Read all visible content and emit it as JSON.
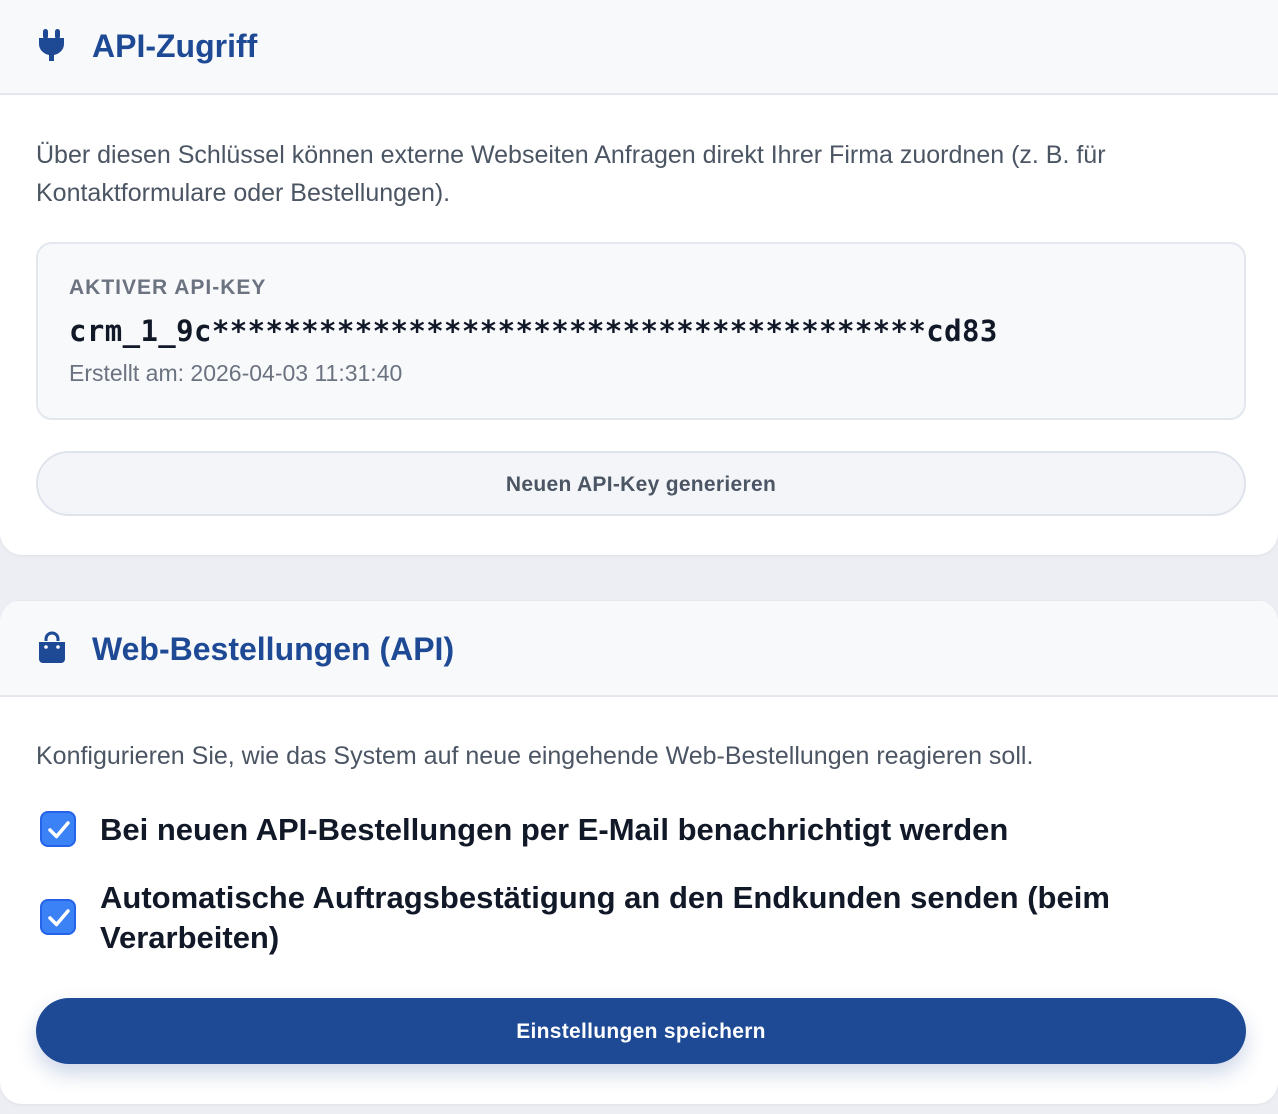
{
  "api_section": {
    "title": "API-Zugriff",
    "icon": "plug-icon",
    "description": "Über diesen Schlüssel können externe Webseiten Anfragen direkt Ihrer Firma zuordnen (z. B. für Kontaktformulare oder Bestellungen).",
    "key_label": "AKTIVER API-KEY",
    "key_value": "crm_1_9c****************************************cd83",
    "created": "Erstellt am: 2026-04-03 11:31:40",
    "generate_button": "Neuen API-Key generieren"
  },
  "web_orders_section": {
    "title": "Web-Bestellungen (API)",
    "icon": "shopping-bag-icon",
    "description": "Konfigurieren Sie, wie das System auf neue eingehende Web-Bestellungen reagieren soll.",
    "options": [
      {
        "label": "Bei neuen API-Bestellungen per E-Mail benachrichtigt werden",
        "checked": true
      },
      {
        "label": "Automatische Auftragsbestätigung an den Endkunden senden (beim Verarbeiten)",
        "checked": true
      }
    ],
    "save_button": "Einstellungen speichern"
  },
  "colors": {
    "accent": "#1e4a95",
    "checkbox": "#3b82f6",
    "background": "#eceef3"
  }
}
